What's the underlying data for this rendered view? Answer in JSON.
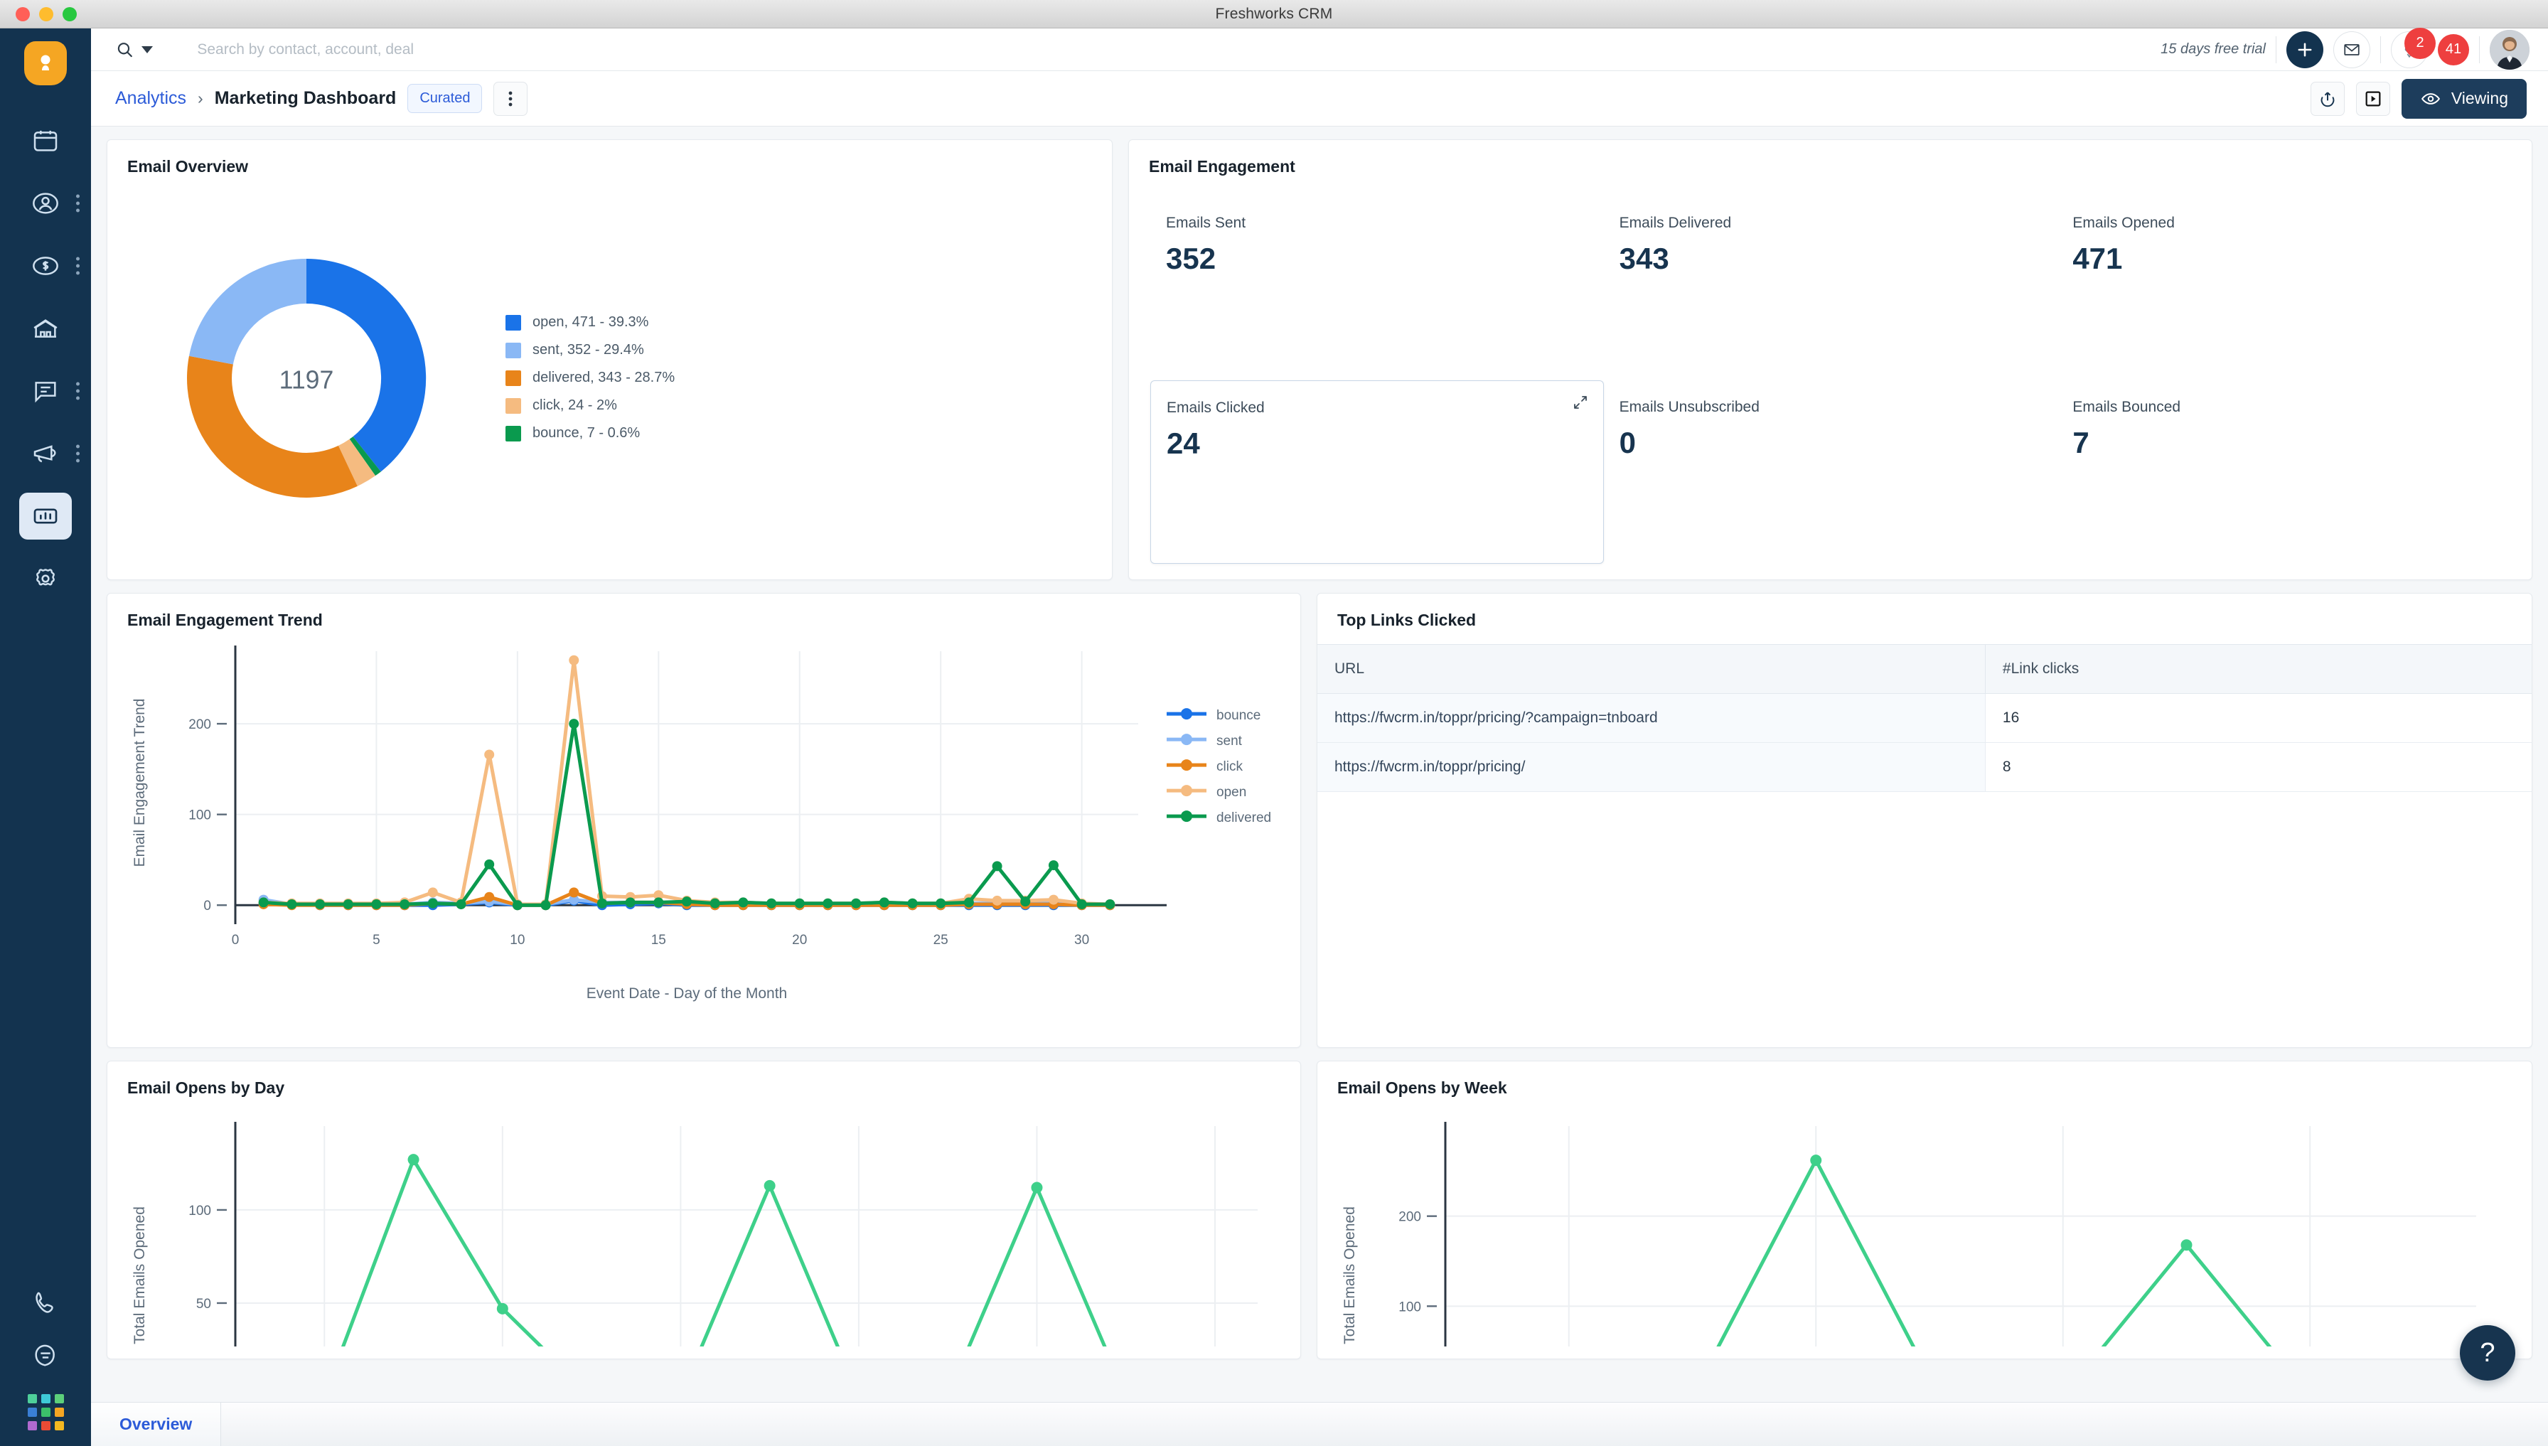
{
  "window": {
    "title": "Freshworks CRM"
  },
  "search": {
    "placeholder": "Search by contact, account, deal",
    "value": ""
  },
  "topbar": {
    "trial_text": "15 days free trial",
    "add_icon": "plus-icon",
    "mail_icon": "envelope-icon",
    "rocket_icon": "rocket-icon",
    "rocket_badge": "2",
    "notification_badge": "41",
    "avatar_name": "user-avatar"
  },
  "breadcrumb": {
    "parent": "Analytics",
    "separator": "›",
    "current": "Marketing Dashboard",
    "chip": "Curated",
    "more_icon": "kebab-menu-icon",
    "share_icon": "share-upload-icon",
    "present_icon": "play-box-icon",
    "view_button": "Viewing",
    "view_icon": "eye-icon"
  },
  "sidebar": {
    "logo": "freshworks-logo",
    "items": [
      {
        "name": "calendar",
        "icon": "calendar-icon",
        "kebab": false,
        "active": false
      },
      {
        "name": "contacts",
        "icon": "person-circle-icon",
        "kebab": true,
        "active": false
      },
      {
        "name": "deals",
        "icon": "dollar-circle-icon",
        "kebab": true,
        "active": false
      },
      {
        "name": "accounts",
        "icon": "building-icon",
        "kebab": false,
        "active": false
      },
      {
        "name": "conversations",
        "icon": "chat-bubble-icon",
        "kebab": true,
        "active": false
      },
      {
        "name": "marketing",
        "icon": "megaphone-icon",
        "kebab": true,
        "active": false
      },
      {
        "name": "analytics",
        "icon": "bar-chart-icon",
        "kebab": false,
        "active": true
      },
      {
        "name": "settings",
        "icon": "gear-icon",
        "kebab": false,
        "active": false
      }
    ],
    "bottom": [
      {
        "name": "phone",
        "icon": "phone-icon"
      },
      {
        "name": "chat",
        "icon": "chat-icon"
      },
      {
        "name": "apps",
        "icon": "app-grid-icon"
      }
    ],
    "grid_colors": [
      "#4ecf9a",
      "#3ec9d6",
      "#5ccf7a",
      "#3a7fd5",
      "#3bbf6a",
      "#f5a623",
      "#b06ad0",
      "#ea4b35",
      "#f5b820"
    ]
  },
  "cards": {
    "email_overview": {
      "title": "Email Overview"
    },
    "email_engagement": {
      "title": "Email Engagement"
    },
    "trend": {
      "title": "Email Engagement Trend"
    },
    "top_links": {
      "title": "Top Links Clicked"
    },
    "opens_day": {
      "title": "Email Opens by Day"
    },
    "opens_week": {
      "title": "Email Opens by Week"
    }
  },
  "kpis": [
    {
      "label": "Emails Sent",
      "value": "352",
      "selected": false
    },
    {
      "label": "Emails Delivered",
      "value": "343",
      "selected": false
    },
    {
      "label": "Emails Opened",
      "value": "471",
      "selected": false
    },
    {
      "label": "Emails Clicked",
      "value": "24",
      "selected": true,
      "expand_icon": "expand-arrows-icon"
    },
    {
      "label": "Emails Unsubscribed",
      "value": "0",
      "selected": false
    },
    {
      "label": "Emails Bounced",
      "value": "7",
      "selected": false
    }
  ],
  "top_links_table": {
    "columns": [
      "URL",
      "#Link clicks"
    ],
    "rows": [
      {
        "url": "https://fwcrm.in/toppr/pricing/?campaign=tnboard",
        "clicks": "16"
      },
      {
        "url": "https://fwcrm.in/toppr/pricing/",
        "clicks": "8"
      }
    ]
  },
  "footer": {
    "tab": "Overview"
  },
  "help": {
    "label": "?"
  },
  "chart_data": [
    {
      "type": "pie",
      "title": "Email Overview",
      "center_label": "1197",
      "legend_position": "right",
      "categories": [
        "open",
        "sent",
        "delivered",
        "click",
        "bounce"
      ],
      "values": [
        471,
        352,
        343,
        24,
        7
      ],
      "percents": [
        "39.3%",
        "29.4%",
        "28.7%",
        "2%",
        "0.6%"
      ],
      "legend_labels": [
        "open,  471 - 39.3%",
        "sent,  352 - 29.4%",
        "delivered,  343 - 28.7%",
        "click,  24 - 2%",
        "bounce,  7 - 0.6%"
      ],
      "colors": [
        "#1a73e8",
        "#8ab8f5",
        "#e8841a",
        "#f5bb80",
        "#0a9a4e"
      ]
    },
    {
      "type": "line",
      "title": "Email Engagement Trend",
      "xlabel": "Event Date - Day of the Month",
      "ylabel": "Email Engagement Trend",
      "x": [
        1,
        2,
        3,
        4,
        5,
        6,
        7,
        8,
        9,
        10,
        11,
        12,
        13,
        14,
        15,
        16,
        17,
        18,
        19,
        20,
        21,
        22,
        23,
        24,
        25,
        26,
        27,
        28,
        29,
        30,
        31
      ],
      "xlim": [
        0,
        32
      ],
      "ylim": [
        -10,
        280
      ],
      "xticks": [
        0,
        5,
        10,
        15,
        20,
        25,
        30
      ],
      "yticks": [
        0,
        100,
        200
      ],
      "grid": true,
      "legend_position": "right",
      "series": [
        {
          "name": "bounce",
          "color": "#1a73e8",
          "values": [
            2,
            1,
            0,
            0,
            0,
            0,
            0,
            1,
            3,
            0,
            0,
            5,
            0,
            1,
            2,
            0,
            0,
            0,
            0,
            0,
            0,
            0,
            0,
            0,
            0,
            0,
            0,
            0,
            0,
            0,
            0
          ]
        },
        {
          "name": "sent",
          "color": "#8ab8f5",
          "values": [
            6,
            1,
            1,
            1,
            1,
            1,
            3,
            2,
            4,
            1,
            1,
            6,
            3,
            3,
            3,
            2,
            1,
            1,
            1,
            1,
            1,
            1,
            1,
            1,
            1,
            2,
            2,
            2,
            2,
            1,
            1
          ]
        },
        {
          "name": "click",
          "color": "#e8841a",
          "values": [
            1,
            0,
            0,
            0,
            0,
            0,
            2,
            1,
            9,
            0,
            0,
            14,
            2,
            3,
            3,
            1,
            0,
            0,
            0,
            0,
            0,
            0,
            0,
            0,
            0,
            1,
            1,
            1,
            1,
            0,
            0
          ]
        },
        {
          "name": "open",
          "color": "#f5bb80",
          "values": [
            3,
            2,
            2,
            2,
            2,
            3,
            14,
            3,
            166,
            1,
            1,
            270,
            10,
            9,
            11,
            5,
            3,
            3,
            2,
            2,
            2,
            2,
            3,
            2,
            2,
            7,
            5,
            5,
            6,
            2,
            1
          ]
        },
        {
          "name": "delivered",
          "color": "#0a9a4e",
          "values": [
            3,
            1,
            1,
            1,
            1,
            1,
            2,
            1,
            45,
            0,
            0,
            200,
            2,
            3,
            3,
            4,
            2,
            3,
            2,
            2,
            2,
            2,
            3,
            2,
            2,
            3,
            43,
            4,
            44,
            1,
            1
          ]
        }
      ]
    },
    {
      "type": "line",
      "title": "Email Opens by Day",
      "ylabel": "Total Emails Opened",
      "yticks": [
        50,
        100
      ],
      "ylim": [
        0,
        145
      ],
      "grid": true,
      "series": [
        {
          "name": "Total Emails Opened",
          "color": "#3ed08a",
          "values": [
            0,
            0,
            127,
            47,
            0,
            0,
            113,
            0,
            0,
            112,
            0,
            0
          ]
        }
      ]
    },
    {
      "type": "line",
      "title": "Email Opens by Week",
      "ylabel": "Total Emails Opened",
      "yticks": [
        100,
        200
      ],
      "ylim": [
        0,
        300
      ],
      "grid": true,
      "series": [
        {
          "name": "Total Emails Opened",
          "color": "#3ed08a",
          "values": [
            0,
            0,
            0,
            262,
            0,
            0,
            168,
            0,
            0
          ]
        }
      ]
    }
  ]
}
